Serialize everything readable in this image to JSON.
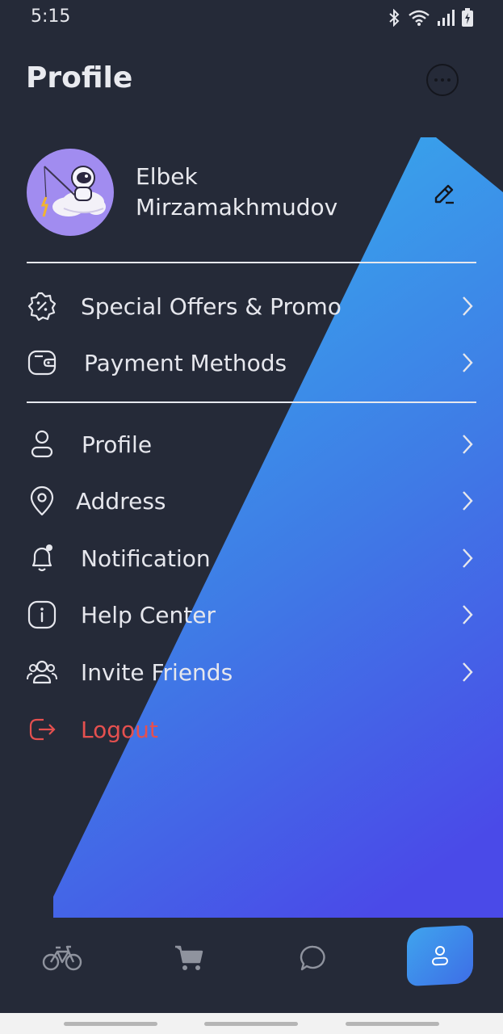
{
  "status_bar": {
    "time": "5:15",
    "icons": [
      "bluetooth-icon",
      "wifi-icon",
      "signal-icon",
      "battery-charging-icon"
    ]
  },
  "header": {
    "title": "Profile",
    "more_icon": "more-horizontal-icon"
  },
  "user": {
    "first_name": "Elbek",
    "last_name": "Mirzamakhmudov",
    "avatar": "astronaut-fishing-on-cloud",
    "edit_icon": "pencil-icon"
  },
  "menu_group_1": [
    {
      "label": "Special Offers & Promo",
      "icon": "discount-badge-icon"
    },
    {
      "label": "Payment Methods",
      "icon": "wallet-icon"
    }
  ],
  "menu_group_2": [
    {
      "label": "Profile",
      "icon": "user-icon"
    },
    {
      "label": "Address",
      "icon": "location-pin-icon"
    },
    {
      "label": "Notification",
      "icon": "bell-icon"
    },
    {
      "label": "Help Center",
      "icon": "info-icon"
    },
    {
      "label": "Invite Friends",
      "icon": "users-icon"
    }
  ],
  "logout": {
    "label": "Logout",
    "icon": "logout-icon"
  },
  "bottom_nav": [
    {
      "name": "bike",
      "icon": "bicycle-icon"
    },
    {
      "name": "cart",
      "icon": "cart-icon"
    },
    {
      "name": "chat",
      "icon": "chat-bubble-icon"
    },
    {
      "name": "profile",
      "icon": "user-icon",
      "active": true
    }
  ],
  "colors": {
    "background": "#252a38",
    "accent_gradient_start": "#3aaded",
    "accent_gradient_end": "#4a4fe8",
    "logout": "#e5504f",
    "avatar_bg": "#a18cf0"
  }
}
